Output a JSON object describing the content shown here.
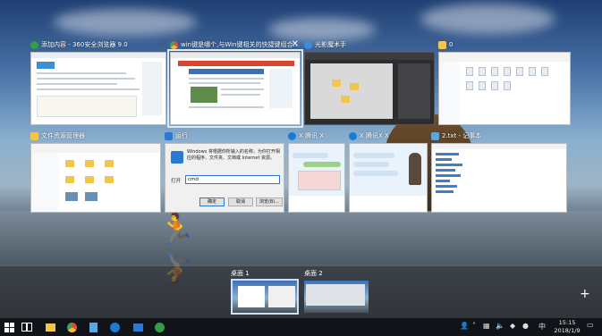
{
  "windows": [
    {
      "title": "添加内容 - 360安全浏览器 9.0",
      "icon": "360-browser-icon",
      "icon_color": "#2f9e45"
    },
    {
      "title": "win键是哪个,与Win键相关的快捷键组合...",
      "icon": "chrome-icon",
      "icon_color": "#e8a21a",
      "close": "✕"
    },
    {
      "title": "光影魔术手",
      "icon": "photo-editor-icon",
      "icon_color": "#3b8fd6"
    },
    {
      "title": "0",
      "icon": "folder-icon",
      "icon_color": "#f3c54f"
    },
    {
      "title": "文件资源管理器",
      "icon": "file-explorer-icon",
      "icon_color": "#f3c54f"
    },
    {
      "title": "运行",
      "icon": "run-icon",
      "icon_color": "#2a7ad1"
    },
    {
      "title": "X 腾讯 X",
      "icon": "qq-icon",
      "icon_color": "#1b7ad6"
    },
    {
      "title": "X 腾讯X X",
      "icon": "qq-icon",
      "icon_color": "#1b7ad6"
    },
    {
      "title": "2.txt - 记事本",
      "icon": "notepad-icon",
      "icon_color": "#59a6e0"
    }
  ],
  "run_dialog": {
    "description": "Windows 将根据你所输入的名称，为你打开相应的程序、文件夹、文档或 Internet 资源。",
    "open_label": "打开",
    "input_value": "cmd",
    "ok": "确定",
    "cancel": "取消",
    "browse": "浏览(B)..."
  },
  "desktops": [
    {
      "label": "桌面 1"
    },
    {
      "label": "桌面 2"
    }
  ],
  "new_desktop": "+",
  "taskbar": {
    "start_icon": "windows-start-icon",
    "ime_label": "中",
    "time": "15:15",
    "date": "2018/1/9"
  },
  "colors": {
    "accent": "#2a7ad1",
    "taskbar": "#101418"
  }
}
